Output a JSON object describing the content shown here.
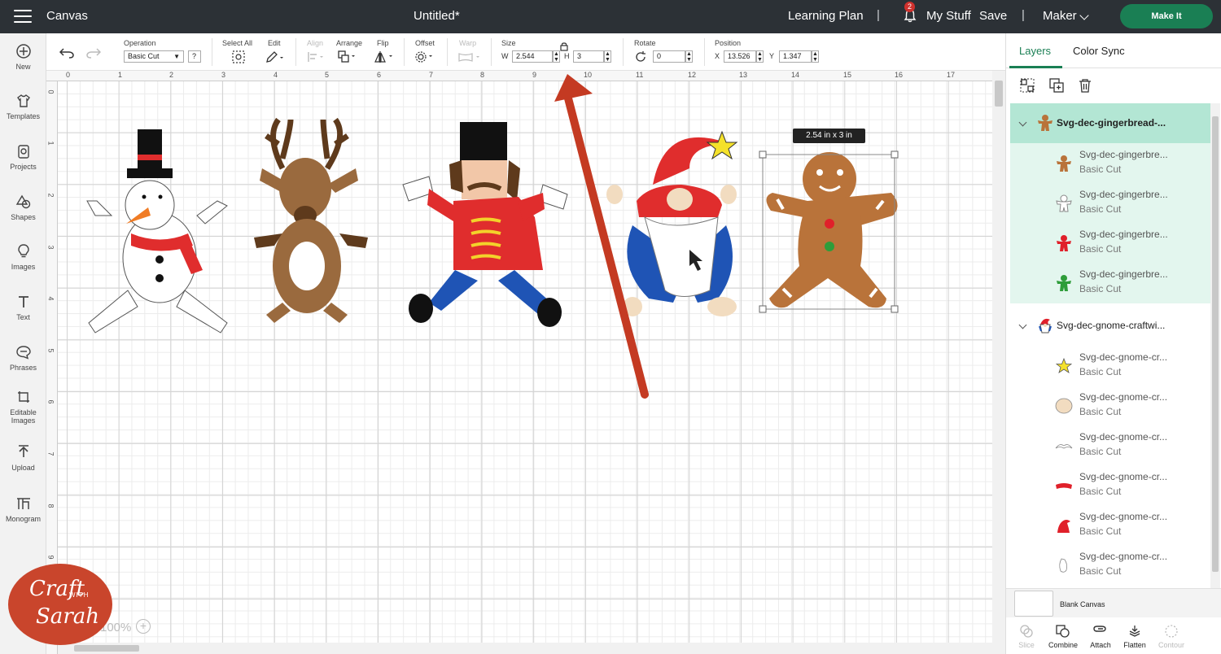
{
  "topbar": {
    "app_title": "Canvas",
    "doc_title": "Untitled*",
    "learning_plan": "Learning Plan",
    "separator": "|",
    "notification_count": "2",
    "my_stuff": "My Stuff",
    "save": "Save",
    "machine": "Maker",
    "make_it": "Make It"
  },
  "leftbar": {
    "items": [
      {
        "label": "New",
        "icon": "plus-circle-icon"
      },
      {
        "label": "Templates",
        "icon": "tshirt-icon"
      },
      {
        "label": "Projects",
        "icon": "projects-icon"
      },
      {
        "label": "Shapes",
        "icon": "shapes-icon"
      },
      {
        "label": "Images",
        "icon": "lightbulb-icon"
      },
      {
        "label": "Text",
        "icon": "text-icon"
      },
      {
        "label": "Phrases",
        "icon": "speech-bubble-icon"
      },
      {
        "label": "Editable Images",
        "icon": "editable-images-icon"
      },
      {
        "label": "Upload",
        "icon": "upload-icon"
      },
      {
        "label": "Monogram",
        "icon": "monogram-icon"
      }
    ]
  },
  "toolbar": {
    "operation_label": "Operation",
    "operation_value": "Basic Cut",
    "help": "?",
    "select_all": "Select All",
    "edit": "Edit",
    "align": "Align",
    "arrange": "Arrange",
    "flip": "Flip",
    "offset": "Offset",
    "warp": "Warp",
    "size_label": "Size",
    "w_label": "W",
    "w_value": "2.544",
    "h_label": "H",
    "h_value": "3",
    "rotate_label": "Rotate",
    "rotate_value": "0",
    "position_label": "Position",
    "x_label": "X",
    "x_value": "13.526",
    "y_label": "Y",
    "y_value": "1.347"
  },
  "canvas": {
    "ruler_top": [
      "0",
      "1",
      "2",
      "3",
      "4",
      "5",
      "6",
      "7",
      "8",
      "9",
      "10",
      "11",
      "12",
      "13",
      "14",
      "15",
      "16",
      "17"
    ],
    "ruler_left": [
      "0",
      "1",
      "2",
      "3",
      "4",
      "5",
      "6",
      "7",
      "8",
      "9"
    ],
    "size_tooltip": "2.54  in x 3  in",
    "zoom": "100%"
  },
  "panel": {
    "tab_layers": "Layers",
    "tab_color_sync": "Color Sync",
    "group1": {
      "name": "Svg-dec-gingerbread-...",
      "layers": [
        {
          "name": "Svg-dec-gingerbre...",
          "op": "Basic Cut",
          "color": "#b9733a"
        },
        {
          "name": "Svg-dec-gingerbre...",
          "op": "Basic Cut",
          "color": "#ffffff"
        },
        {
          "name": "Svg-dec-gingerbre...",
          "op": "Basic Cut",
          "color": "#e0202a"
        },
        {
          "name": "Svg-dec-gingerbre...",
          "op": "Basic Cut",
          "color": "#2e9d3a"
        }
      ]
    },
    "group2": {
      "name": "Svg-dec-gnome-craftwi...",
      "layers": [
        {
          "name": "Svg-dec-gnome-cr...",
          "op": "Basic Cut",
          "color": "#f4e12a"
        },
        {
          "name": "Svg-dec-gnome-cr...",
          "op": "Basic Cut",
          "color": "#f2dcc0"
        },
        {
          "name": "Svg-dec-gnome-cr...",
          "op": "Basic Cut",
          "color": "#ffffff"
        },
        {
          "name": "Svg-dec-gnome-cr...",
          "op": "Basic Cut",
          "color": "#e0202a"
        },
        {
          "name": "Svg-dec-gnome-cr...",
          "op": "Basic Cut",
          "color": "#e0202a"
        },
        {
          "name": "Svg-dec-gnome-cr...",
          "op": "Basic Cut",
          "color": "#ffffff"
        }
      ]
    },
    "blank_canvas": "Blank Canvas",
    "bottom_tools": [
      "Slice",
      "Combine",
      "Attach",
      "Flatten",
      "Contour"
    ]
  },
  "watermark": {
    "line1": "Craft",
    "line2": "WITH",
    "line3": "Sarah"
  },
  "colors": {
    "topbar_bg": "#2c3136",
    "accent_green": "#1a7f54",
    "selected_group": "#b3e6d4",
    "arrow_red": "#c43a22"
  }
}
